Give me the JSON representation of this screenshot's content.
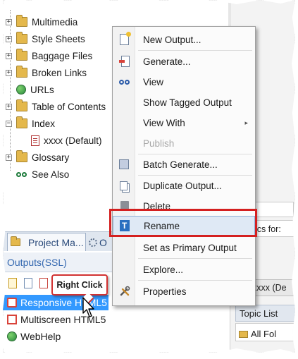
{
  "tree": {
    "items": [
      {
        "label": "Multimedia",
        "icon": "folder-icon"
      },
      {
        "label": "Style Sheets",
        "icon": "folder-icon"
      },
      {
        "label": "Baggage Files",
        "icon": "folder-icon"
      },
      {
        "label": "Broken Links",
        "icon": "folder-icon"
      },
      {
        "label": "URLs",
        "icon": "globe-icon"
      },
      {
        "label": "Table of Contents",
        "icon": "folder-icon"
      },
      {
        "label": "Index",
        "icon": "folder-icon"
      },
      {
        "label": "xxxx (Default)",
        "icon": "document-icon"
      },
      {
        "label": "Glossary",
        "icon": "folder-icon"
      },
      {
        "label": "See Also",
        "icon": "see-also-icon"
      }
    ],
    "expanders": [
      "+",
      "+",
      "+",
      "+",
      "",
      "+",
      "−",
      "",
      "+",
      ""
    ]
  },
  "tabs": {
    "project_manager": "Project Ma...",
    "second": "O"
  },
  "outputs": {
    "header": "Outputs(SSL)",
    "items": [
      "Responsive HTML5",
      "Multiscreen HTML5",
      "WebHelp"
    ]
  },
  "callout": "Right Click",
  "context_menu": {
    "items": [
      {
        "label": "New Output...",
        "icon": "new-output-icon",
        "enabled": true
      },
      {
        "label": "Generate...",
        "icon": "generate-icon",
        "enabled": true
      },
      {
        "label": "View",
        "icon": "view-icon",
        "enabled": true
      },
      {
        "label": "Show Tagged Output",
        "icon": "",
        "enabled": true
      },
      {
        "label": "View With",
        "icon": "",
        "enabled": true,
        "submenu": true
      },
      {
        "label": "Publish",
        "icon": "",
        "enabled": false
      },
      {
        "label": "Batch Generate...",
        "icon": "batch-generate-icon",
        "enabled": true
      },
      {
        "label": "Duplicate Output...",
        "icon": "duplicate-icon",
        "enabled": true
      },
      {
        "label": "Delete",
        "icon": "delete-icon",
        "enabled": true
      },
      {
        "label": "Rename",
        "icon": "rename-icon",
        "enabled": true,
        "highlighted": true
      },
      {
        "label": "Set as Primary Output",
        "icon": "",
        "enabled": true
      },
      {
        "label": "Explore...",
        "icon": "",
        "enabled": true
      },
      {
        "label": "Properties",
        "icon": "properties-icon",
        "enabled": true
      }
    ],
    "submenu_arrow": "▸"
  },
  "right_panel": {
    "search_label": "ics for:",
    "pane_title": "xxxx (De",
    "topic_list_tab": "Topic List",
    "all_folders": "All Fol"
  },
  "colors": {
    "selection": "#3399ff",
    "highlight_box": "#d42020",
    "link_blue": "#3468b0"
  }
}
